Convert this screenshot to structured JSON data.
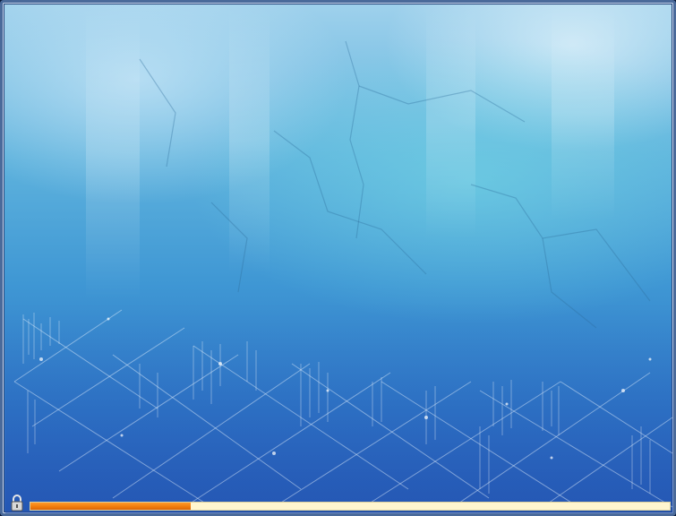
{
  "screen": {
    "type": "boot-splash",
    "colors": {
      "progress_fill": "#f07a0a",
      "progress_track": "#fff6cf",
      "frame": "#4a6a9a"
    }
  },
  "lock": {
    "icon": "lock-icon"
  },
  "progress": {
    "fraction": 0.25
  }
}
